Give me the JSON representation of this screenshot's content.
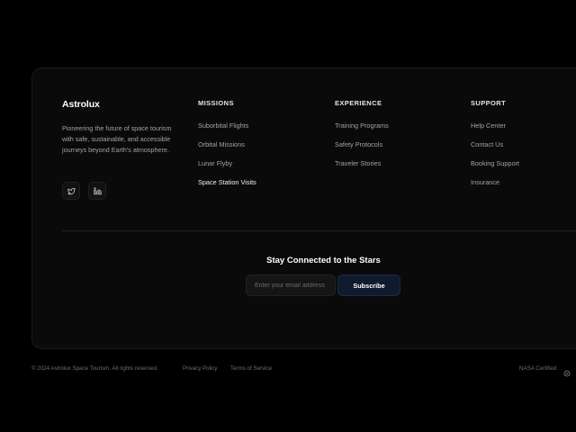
{
  "brand": {
    "name": "Astrolux",
    "description": "Pioneering the future of space tourism with safe, sustainable, and accessible journeys beyond Earth's atmosphere."
  },
  "social": [
    {
      "icon": "twitter-icon"
    },
    {
      "icon": "linkedin-icon"
    }
  ],
  "columns": {
    "missions": {
      "heading": "MISSIONS",
      "links": [
        "Suborbital Flights",
        "Orbital Missions",
        "Lunar Flyby",
        "Space Station Visits"
      ]
    },
    "experience": {
      "heading": "EXPERIENCE",
      "links": [
        "Training Programs",
        "Safety Protocols",
        "Traveler Stories"
      ]
    },
    "support": {
      "heading": "SUPPORT",
      "links": [
        "Help Center",
        "Contact Us",
        "Booking Support",
        "Insurance"
      ]
    }
  },
  "newsletter": {
    "title": "Stay Connected to the Stars",
    "email_placeholder": "Enter your email address",
    "email_value": "",
    "subscribe_label": "Subscribe"
  },
  "bottom": {
    "copyright": "© 2024 Astrolux Space Tourism. All rights reserved.",
    "privacy": "Privacy Policy",
    "terms": "Terms of Service",
    "certified": "NASA Certified",
    "certified_icon": "shield-check-icon"
  },
  "colors": {
    "background": "#000000",
    "card": "#0a0a0a",
    "subscribe_button": "#0f1a2e"
  }
}
